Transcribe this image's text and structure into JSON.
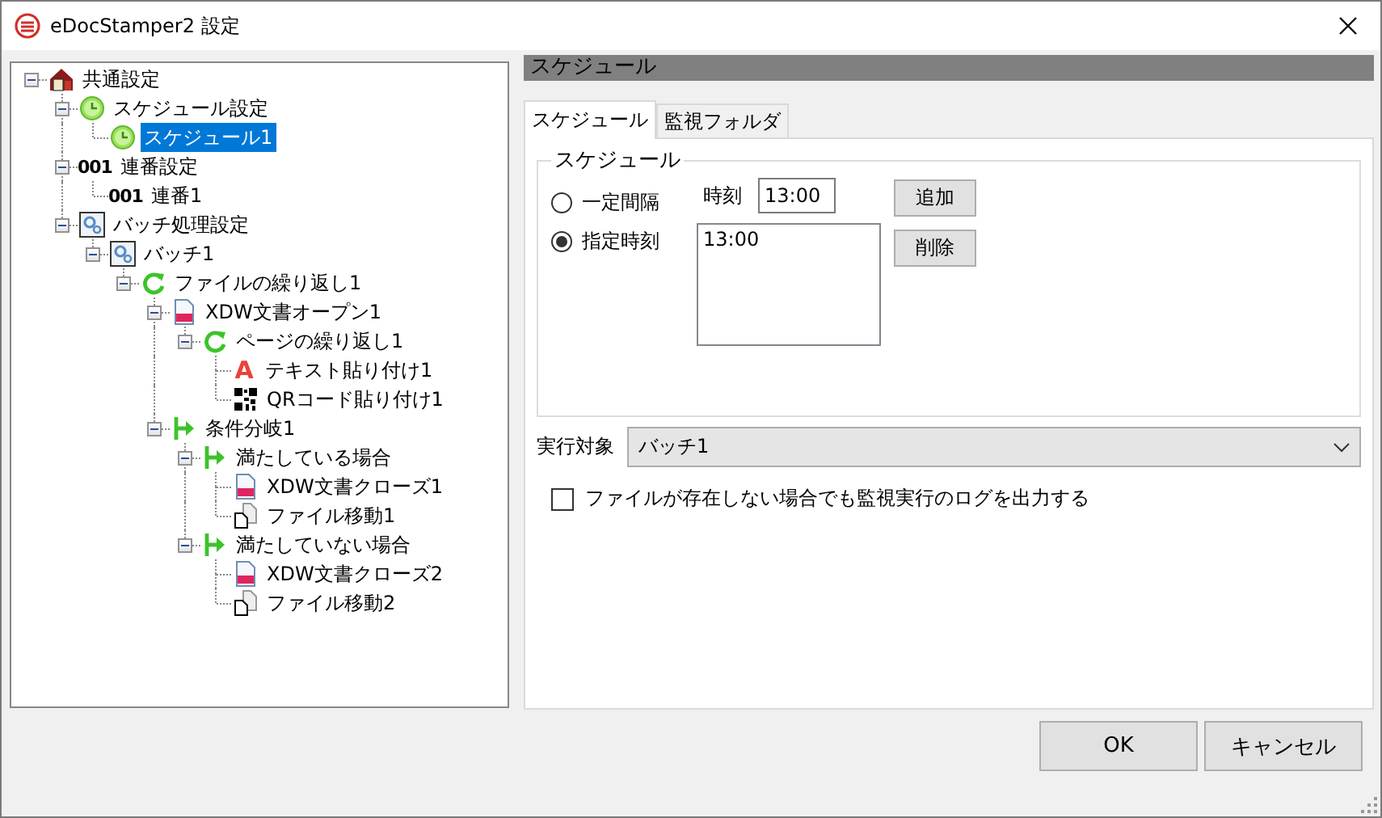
{
  "window": {
    "title": "eDocStamper2 設定"
  },
  "tree": [
    {
      "label": "共通設定",
      "kind": "house",
      "selected": false,
      "expanded": true,
      "children": [
        {
          "label": "スケジュール設定",
          "kind": "clock",
          "selected": false,
          "expanded": true,
          "children": [
            {
              "label": "スケジュール1",
              "kind": "clock",
              "selected": true
            }
          ]
        },
        {
          "label": "連番設定",
          "kind": "glyph",
          "glyph": "001",
          "selected": false,
          "expanded": true,
          "children": [
            {
              "label": "連番1",
              "kind": "glyph",
              "glyph": "001",
              "selected": false
            }
          ]
        },
        {
          "label": "バッチ処理設定",
          "kind": "gear",
          "selected": false,
          "expanded": true,
          "children": [
            {
              "label": "バッチ1",
              "kind": "gear",
              "selected": false,
              "expanded": true,
              "children": [
                {
                  "label": "ファイルの繰り返し1",
                  "kind": "loop",
                  "selected": false,
                  "expanded": true,
                  "children": [
                    {
                      "label": "XDW文書オープン1",
                      "kind": "doc",
                      "selected": false,
                      "expanded": true,
                      "children": [
                        {
                          "label": "ページの繰り返し1",
                          "kind": "loop",
                          "selected": false,
                          "expanded": true,
                          "children": [
                            {
                              "label": "テキスト貼り付け1",
                              "kind": "letter",
                              "glyph": "A",
                              "selected": false
                            },
                            {
                              "label": "QRコード貼り付け1",
                              "kind": "qr",
                              "selected": false
                            }
                          ]
                        }
                      ]
                    },
                    {
                      "label": "条件分岐1",
                      "kind": "branch",
                      "selected": false,
                      "expanded": true,
                      "children": [
                        {
                          "label": "満たしている場合",
                          "kind": "branch",
                          "selected": false,
                          "expanded": true,
                          "children": [
                            {
                              "label": "XDW文書クローズ1",
                              "kind": "doc",
                              "selected": false
                            },
                            {
                              "label": "ファイル移動1",
                              "kind": "file",
                              "selected": false
                            }
                          ]
                        },
                        {
                          "label": "満たしていない場合",
                          "kind": "branch",
                          "selected": false,
                          "expanded": true,
                          "children": [
                            {
                              "label": "XDW文書クローズ2",
                              "kind": "doc",
                              "selected": false
                            },
                            {
                              "label": "ファイル移動2",
                              "kind": "file",
                              "selected": false
                            }
                          ]
                        }
                      ]
                    }
                  ]
                }
              ]
            }
          ]
        }
      ]
    }
  ],
  "panel": {
    "header": "スケジュール",
    "tabs": [
      {
        "label": "スケジュール",
        "selected": true
      },
      {
        "label": "監視フォルダ",
        "selected": false
      }
    ],
    "group": {
      "title": "スケジュール",
      "modes": [
        {
          "label": "一定間隔",
          "selected": false
        },
        {
          "label": "指定時刻",
          "selected": true
        }
      ],
      "time_label": "時刻",
      "time_value": "13:00",
      "times": [
        "13:00"
      ],
      "buttons": [
        "追加",
        "削除"
      ]
    },
    "target": {
      "label": "実行対象",
      "value": "バッチ1"
    },
    "log_option": {
      "label": "ファイルが存在しない場合でも監視実行のログを出力する",
      "checked": false
    }
  },
  "buttons": [
    "OK",
    "キャンセル"
  ]
}
